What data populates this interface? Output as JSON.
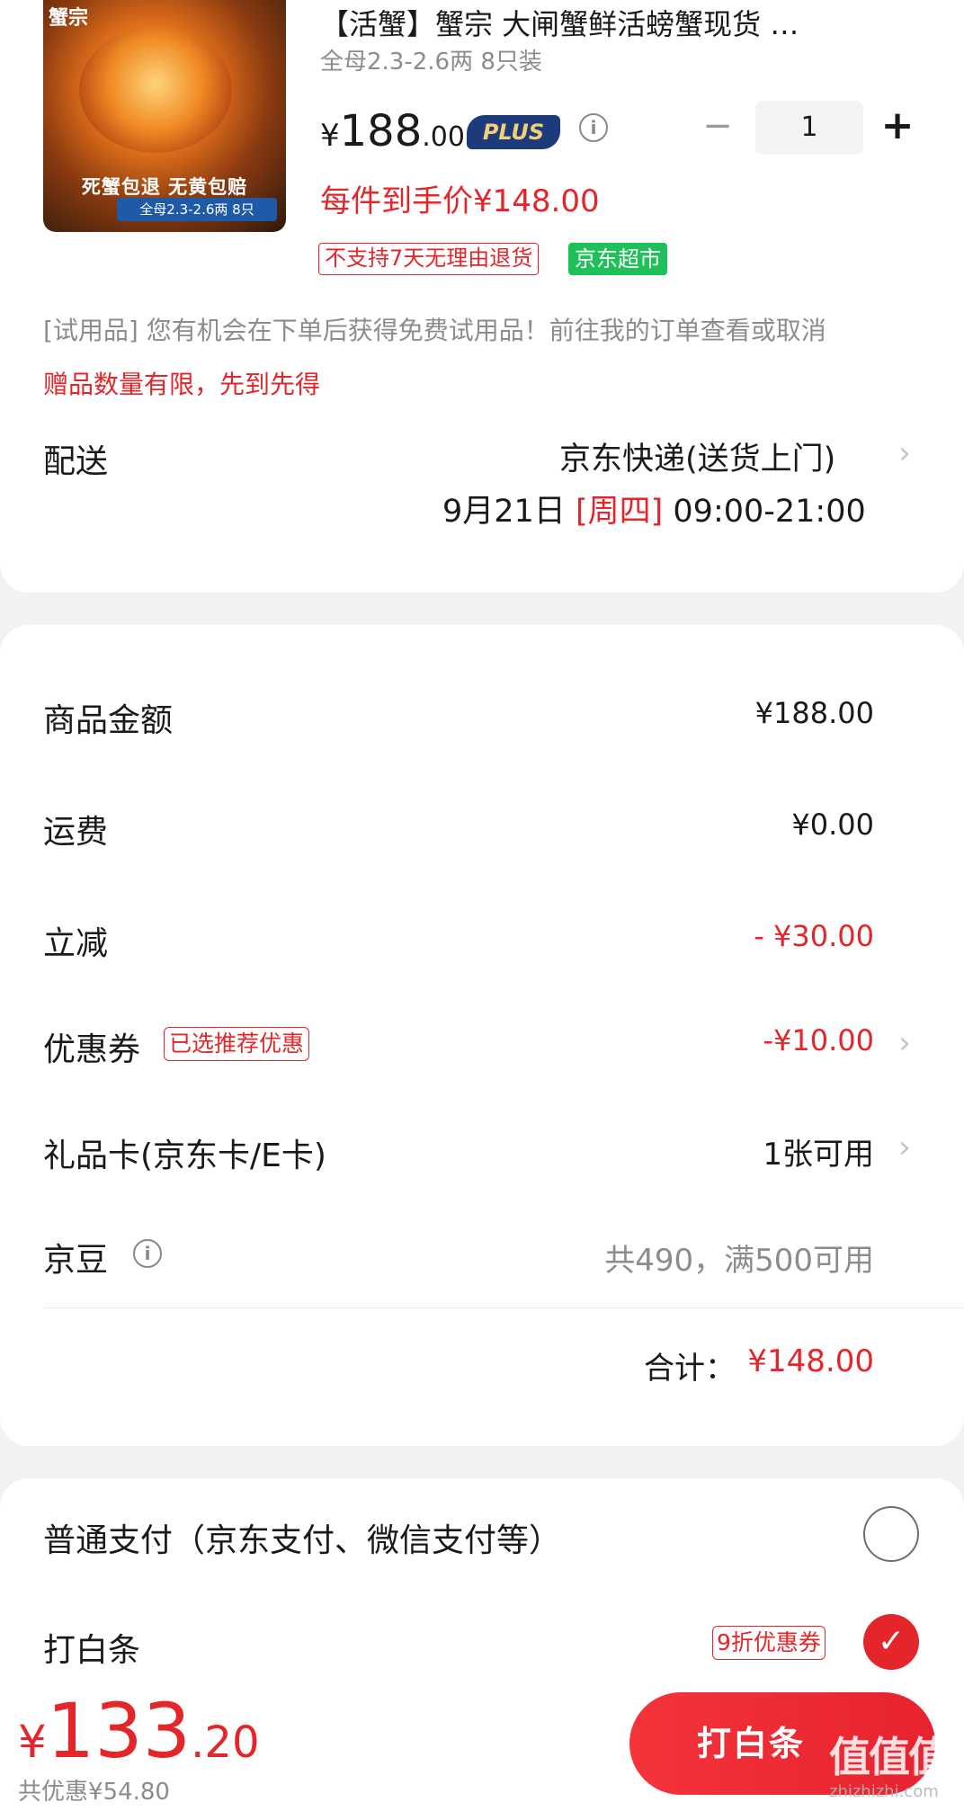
{
  "product": {
    "image_brand": "蟹宗",
    "image_slogan": "死蟹包退 无黄包赔",
    "image_spec": "全母2.3-2.6两 8只",
    "title": "【活蟹】蟹宗 大闸蟹鲜活螃蟹现货 …",
    "spec": "全母2.3-2.6两 8只装",
    "price_currency": "¥",
    "price_int": "188",
    "price_dec": ".00",
    "plus_badge": "PLUS",
    "hand_price": "每件到手价¥148.00",
    "quantity": "1",
    "minus_symbol": "−",
    "plus_symbol": "+",
    "tags": [
      "不支持7天无理由退货",
      "京东超市"
    ],
    "trial_note": "[试用品] 您有机会在下单后获得免费试用品！前往我的订单查看或取消",
    "gift_limit": "赠品数量有限，先到先得"
  },
  "delivery": {
    "label": "配送",
    "method": "京东快递(送货上门)",
    "date": "9月21日",
    "weekday": "[周四]",
    "time": "09:00-21:00"
  },
  "summary": {
    "goods_label": "商品金额",
    "goods_value": "¥188.00",
    "shipping_label": "运费",
    "shipping_value": "¥0.00",
    "discount_label": "立减",
    "discount_value": "- ¥30.00",
    "coupon_label": "优惠券",
    "coupon_tag": "已选推荐优惠",
    "coupon_value": "-¥10.00",
    "giftcard_label": "礼品卡(京东卡/E卡)",
    "giftcard_value": "1张可用",
    "jingdou_label": "京豆",
    "jingdou_value": "共490，满500可用",
    "total_label": "合计：",
    "total_value": "¥148.00"
  },
  "payment": {
    "normal_label": "普通支付（京东支付、微信支付等）",
    "baitiao_label": "打白条",
    "baitiao_coupon": "9折优惠券"
  },
  "bottom": {
    "currency": "¥",
    "amount_int": "133",
    "amount_dec": ".20",
    "saved": "共优惠¥54.80",
    "pay_button": "打白条",
    "watermark": "值值值",
    "watermark_sub": "zhizhizhi.com"
  },
  "colors": {
    "accent_red": "#e4262a",
    "plus_navy": "#1d3a7a",
    "supermarket_green": "#1fbf5a"
  },
  "icons": [
    "info-icon",
    "chevron-right-icon",
    "check-icon",
    "radio-unselected-icon"
  ]
}
